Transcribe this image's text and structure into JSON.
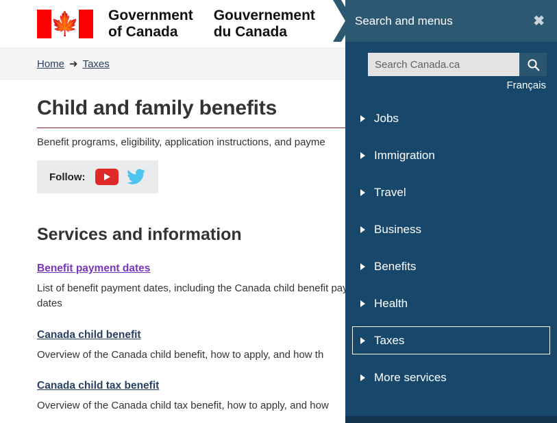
{
  "header": {
    "flag_icon": "canada-flag-icon",
    "wordmark_en": "Government\nof Canada",
    "wordmark_fr": "Gouvernement\ndu Canada"
  },
  "breadcrumb": {
    "items": [
      {
        "label": "Home"
      },
      {
        "label": "Taxes"
      }
    ],
    "separator": "➜"
  },
  "main": {
    "page_title": "Child and family benefits",
    "lede": "Benefit programs, eligibility, application instructions, and payme",
    "follow": {
      "label": "Follow:",
      "youtube_icon": "youtube-icon",
      "twitter_icon": "twitter-icon"
    },
    "section_title": "Services and information",
    "services": [
      {
        "link": "Benefit payment dates",
        "visited": true,
        "desc": "List of benefit payment dates, including the Canada child benefit payment dates"
      },
      {
        "link": "Canada child benefit",
        "visited": false,
        "desc": "Overview of the Canada child benefit, how to apply, and how th"
      },
      {
        "link": "Canada child tax benefit",
        "visited": false,
        "desc": "Overview of the Canada child tax benefit, how to apply, and how"
      }
    ]
  },
  "panel": {
    "title": "Search and menus",
    "close_icon": "close-icon",
    "search": {
      "placeholder": "Search Canada.ca",
      "value": "",
      "button_icon": "search-icon"
    },
    "language_toggle": "Français",
    "menu_items": [
      {
        "label": "Jobs",
        "focused": false
      },
      {
        "label": "Immigration",
        "focused": false
      },
      {
        "label": "Travel",
        "focused": false
      },
      {
        "label": "Business",
        "focused": false
      },
      {
        "label": "Benefits",
        "focused": false
      },
      {
        "label": "Health",
        "focused": false
      },
      {
        "label": "Taxes",
        "focused": true
      },
      {
        "label": "More services",
        "focused": false
      }
    ]
  },
  "colors": {
    "panel_bg": "#17486b",
    "panel_header_bg": "#2c5871",
    "link": "#284162",
    "visited_link": "#7834bc",
    "title_rule": "#8b2331",
    "flag_red": "#ff0000"
  }
}
